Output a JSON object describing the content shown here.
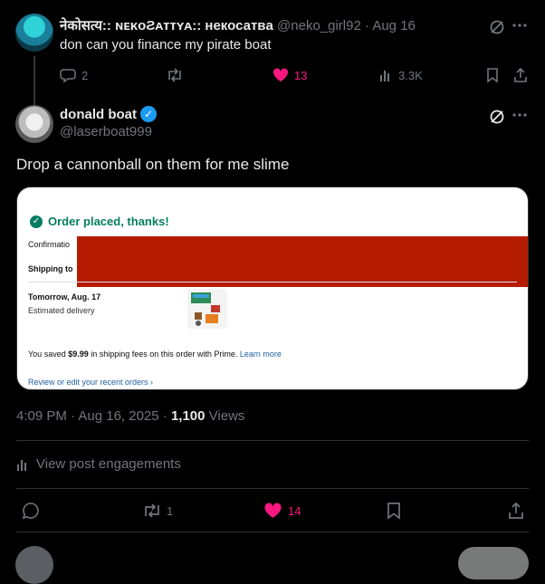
{
  "reply_tweet": {
    "display_name": "नेकोसत्य:: ɴᴇᴋᴏƧᴀᴛᴛʏᴀ:: некосатвa",
    "handle": "@neko_girl92",
    "date": "· Aug 16",
    "text": "don can you finance my pirate boat",
    "replies": "2",
    "likes": "13",
    "views": "3.3K"
  },
  "main_tweet": {
    "display_name": "donald boat",
    "handle": "@laserboat999",
    "text": "Drop a cannonball on them for me slime",
    "timestamp": "4:09 PM · Aug 16, 2025 ·",
    "views_count": "1,100",
    "views_label": "Views",
    "engagements_label": "View post engagements",
    "retweets": "1",
    "likes": "14"
  },
  "order_card": {
    "title": "Order placed, thanks!",
    "confirmation_label": "Confirmatio",
    "shipping_label": "Shipping to",
    "delivery_date": "Tomorrow, Aug. 17",
    "delivery_note": "Estimated delivery",
    "saved_prefix": "You saved ",
    "saved_amount": "$9.99",
    "saved_suffix": " in shipping fees on this order with Prime. ",
    "learn_more": "Learn more",
    "review_link": "Review or edit your recent orders ›"
  },
  "colors": {
    "like": "#f91880",
    "verified": "#1d9bf0",
    "order_green": "#067d62",
    "redaction": "#b51b00"
  }
}
